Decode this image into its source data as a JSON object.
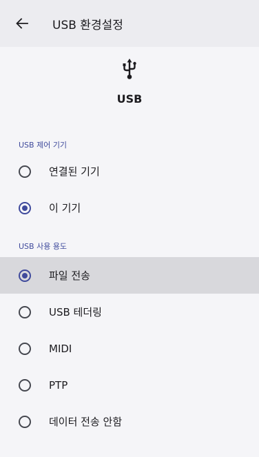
{
  "appbar": {
    "title": "USB 환경설정",
    "back_icon": "arrow-back-icon"
  },
  "hero": {
    "icon": "usb-icon",
    "label": "USB"
  },
  "control_section": {
    "header": "USB 제어 기기",
    "options": [
      {
        "label": "연결된 기기",
        "checked": false
      },
      {
        "label": "이 기기",
        "checked": true
      }
    ]
  },
  "usage_section": {
    "header": "USB 사용 용도",
    "options": [
      {
        "label": "파일 전송",
        "checked": true
      },
      {
        "label": "USB 테더링",
        "checked": false
      },
      {
        "label": "MIDI",
        "checked": false
      },
      {
        "label": "PTP",
        "checked": false
      },
      {
        "label": "데이터 전송 안함",
        "checked": false
      }
    ]
  },
  "colors": {
    "accent": "#3f4a9c",
    "appbar_bg": "#ececf0",
    "page_bg": "#f5f5f8",
    "highlight_bg": "#d8d8dc"
  }
}
